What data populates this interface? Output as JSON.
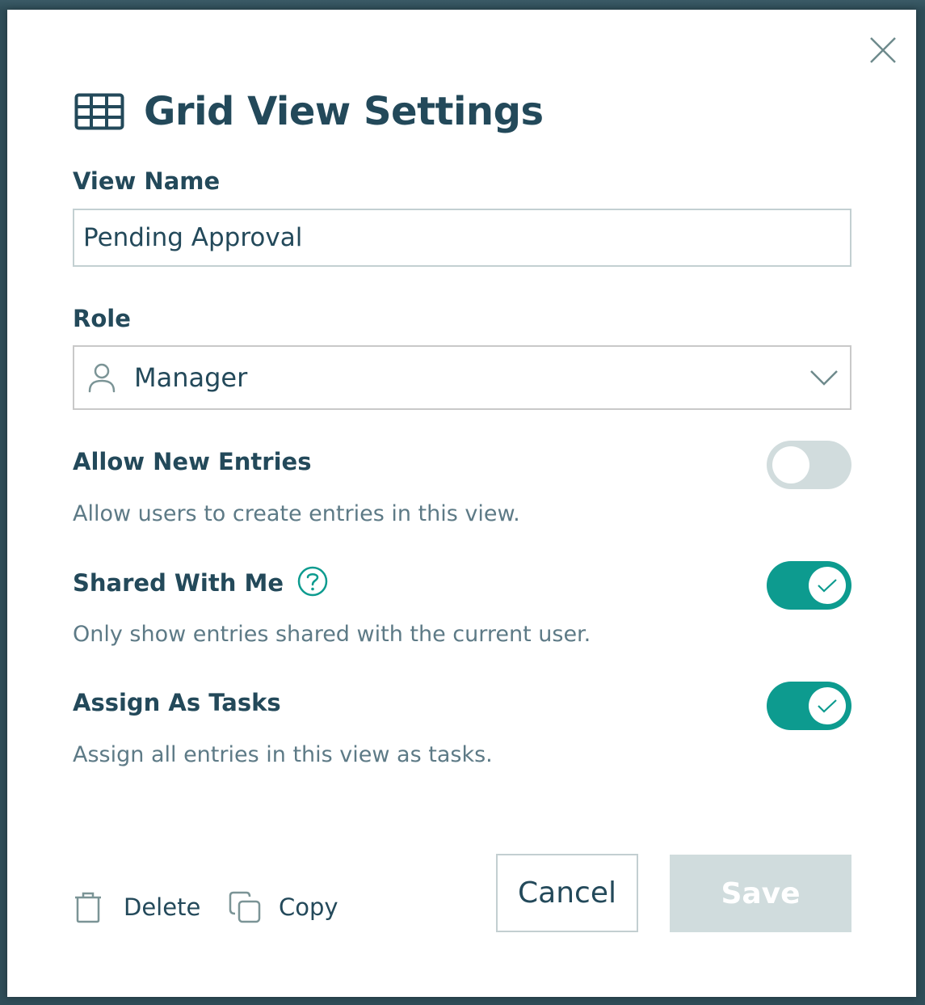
{
  "dialog": {
    "title": "Grid View Settings",
    "title_icon": "grid-icon",
    "close_icon": "close-icon"
  },
  "view_name": {
    "label": "View Name",
    "value": "Pending Approval"
  },
  "role": {
    "label": "Role",
    "icon": "person-icon",
    "selected": "Manager",
    "dropdown_icon": "chevron-down-icon"
  },
  "toggles": [
    {
      "label": "Allow New Entries",
      "description": "Allow users to create entries in this view.",
      "enabled": false,
      "has_help": false
    },
    {
      "label": "Shared With Me",
      "description": "Only show entries shared with the current user.",
      "enabled": true,
      "has_help": true
    },
    {
      "label": "Assign As Tasks",
      "description": "Assign all entries in this view as tasks.",
      "enabled": true,
      "has_help": false
    }
  ],
  "footer": {
    "delete_label": "Delete",
    "delete_icon": "trash-icon",
    "copy_label": "Copy",
    "copy_icon": "copy-icon",
    "cancel_label": "Cancel",
    "save_label": "Save",
    "save_disabled": true
  },
  "colors": {
    "primary_text": "#23495a",
    "secondary_text": "#5d7a86",
    "accent": "#0d9b8f",
    "toggle_off": "#d1dcdd",
    "save_disabled_bg": "#d0dcdd",
    "backdrop": "#2f4d58"
  }
}
